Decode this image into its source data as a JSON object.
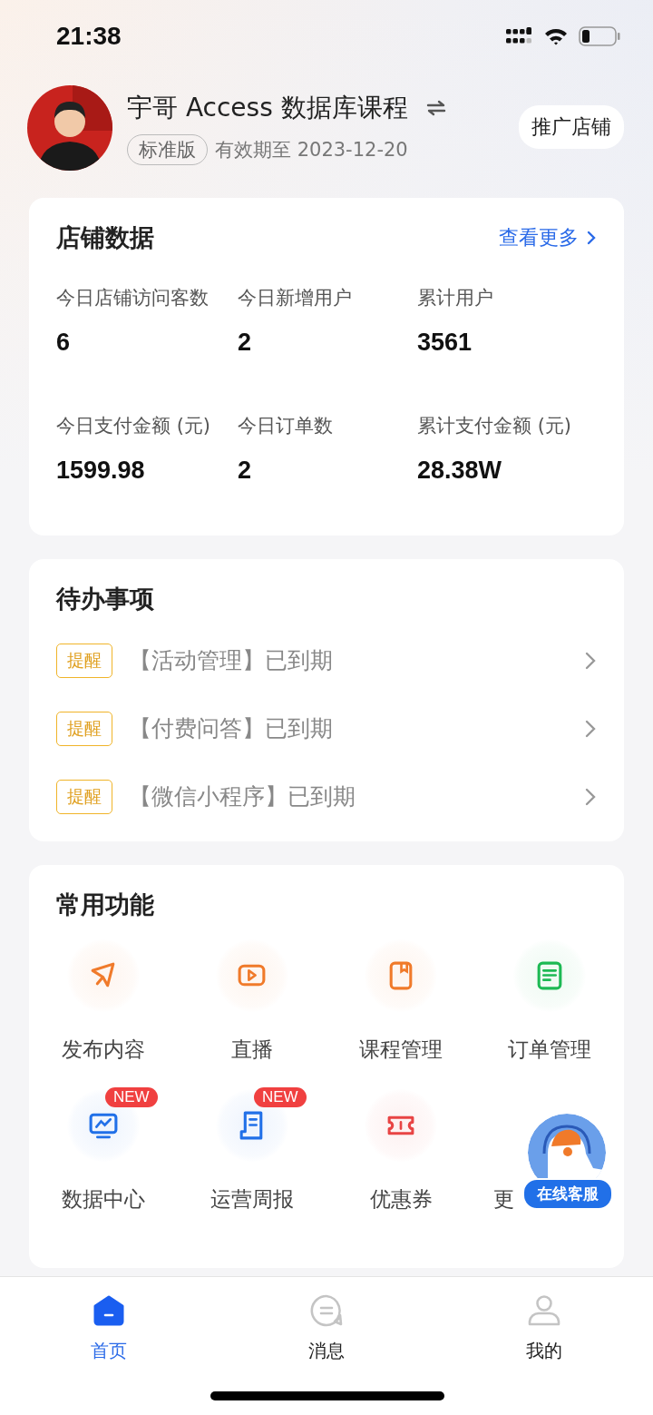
{
  "status_bar": {
    "time": "21:38"
  },
  "shop": {
    "name": "宇哥 Access 数据库课程",
    "edition": "标准版",
    "expiry": "有效期至 2023-12-20",
    "promote_button": "推广店铺"
  },
  "shop_data": {
    "title": "店铺数据",
    "more_link": "查看更多",
    "stats": [
      {
        "label": "今日店铺访问客数",
        "value": "6"
      },
      {
        "label": "今日新增用户",
        "value": "2"
      },
      {
        "label": "累计用户",
        "value": "3561"
      },
      {
        "label": "今日支付金额 (元)",
        "value": "1599.98"
      },
      {
        "label": "今日订单数",
        "value": "2"
      },
      {
        "label": "累计支付金额 (元)",
        "value": "28.38W"
      }
    ]
  },
  "todos": {
    "title": "待办事项",
    "items": [
      {
        "tag": "提醒",
        "text": "【活动管理】已到期"
      },
      {
        "tag": "提醒",
        "text": "【付费问答】已到期"
      },
      {
        "tag": "提醒",
        "text": "【微信小程序】已到期"
      }
    ]
  },
  "functions": {
    "title": "常用功能",
    "items": [
      {
        "kind": "send",
        "label": "发布内容",
        "color": "#f07a2a"
      },
      {
        "kind": "live",
        "label": "直播",
        "color": "#f07a2a"
      },
      {
        "kind": "course",
        "label": "课程管理",
        "color": "#f07a2a"
      },
      {
        "kind": "order",
        "label": "订单管理",
        "color": "#1db954"
      },
      {
        "kind": "data",
        "label": "数据中心",
        "color": "#2170e8",
        "badge": "NEW"
      },
      {
        "kind": "report",
        "label": "运营周报",
        "color": "#2170e8",
        "badge": "NEW"
      },
      {
        "kind": "coupon",
        "label": "优惠券",
        "color": "#e84444"
      },
      {
        "label": "更"
      }
    ]
  },
  "support_button": {
    "label": "在线客服"
  },
  "tab_bar": [
    {
      "kind": "home",
      "label": "首页",
      "selected": true
    },
    {
      "kind": "message",
      "label": "消息",
      "selected": false
    },
    {
      "kind": "profile",
      "label": "我的",
      "selected": false
    }
  ]
}
